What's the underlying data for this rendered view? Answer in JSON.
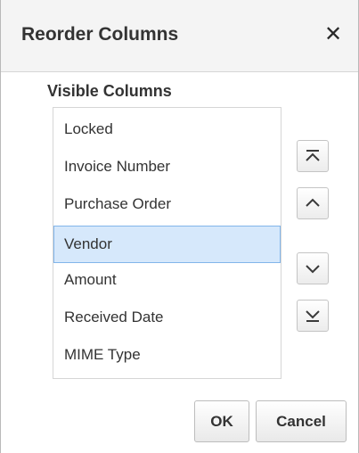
{
  "dialog": {
    "title": "Reorder Columns",
    "close_icon": "close-icon",
    "close_glyph": "✕"
  },
  "columns": {
    "label": "Visible Columns",
    "items": [
      {
        "label": "Locked",
        "selected": false
      },
      {
        "label": "Invoice Number",
        "selected": false
      },
      {
        "label": "Purchase Order",
        "selected": false
      },
      {
        "label": "Vendor",
        "selected": true
      },
      {
        "label": "Amount",
        "selected": false
      },
      {
        "label": "Received Date",
        "selected": false
      },
      {
        "label": "MIME Type",
        "selected": false
      }
    ]
  },
  "move_buttons": [
    {
      "name": "move-to-top-button",
      "icon": "move-top-icon"
    },
    {
      "name": "move-up-button",
      "icon": "chevron-up-icon"
    },
    {
      "name": "move-down-button",
      "icon": "chevron-down-icon"
    },
    {
      "name": "move-to-bottom-button",
      "icon": "move-bottom-icon"
    }
  ],
  "footer": {
    "ok_label": "OK",
    "cancel_label": "Cancel"
  },
  "colors": {
    "selected_background": "#d6e8fb",
    "selected_border": "#82b5ea",
    "titlebar_background": "#f4f4f4"
  }
}
